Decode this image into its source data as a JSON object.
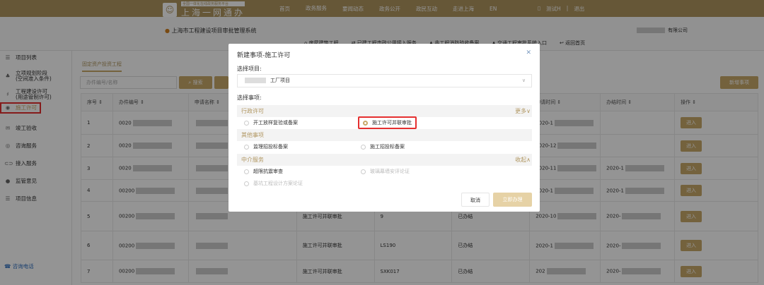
{
  "header": {
    "logo_sub": "全国一体化在线政务服务平台",
    "logo_title": "上海一网通办",
    "nav": [
      "首页",
      "政务服务",
      "要闻动态",
      "政务公开",
      "政民互动",
      "走进上海",
      "EN"
    ],
    "active_nav": 1,
    "user": "测试H",
    "sep": "|",
    "logout": "退出"
  },
  "subheader": {
    "system_name": "上海市工程建设项目审批管理系统",
    "company": "有限公司",
    "links": [
      "房屋建筑工程",
      "已建工程市政公用接入服务",
      "非工程消防验收备案",
      "交通工程审批系统入口",
      "返回首页"
    ]
  },
  "sidebar": {
    "items": [
      "项目列表",
      "立项规划阶段\n(空间准入条件)",
      "工程建设许可\n(用途管制许可)",
      "施工许可",
      "竣工验收",
      "咨询服务",
      "接入服务",
      "监管意见",
      "项目信息"
    ],
    "active": 3,
    "phone": "咨询电话"
  },
  "main": {
    "tab": "固定资产投资工程",
    "search_placeholder": "办件编号/名称",
    "search_btn": "搜索",
    "add_btn": "新增事项",
    "columns": [
      "序号 ⇕",
      "办件编号 ⇕",
      "申请名称 ⇕",
      "事项名称",
      "",
      "",
      "申请时间 ⇕",
      "办结时间 ⇕",
      "操作 ⇕"
    ],
    "rows": [
      {
        "no": "1",
        "code": "0020",
        "item": "",
        "num": "",
        "status": "",
        "apply": "2020-1",
        "done": "",
        "op": "进入"
      },
      {
        "no": "2",
        "code": "0020",
        "item": "",
        "num": "",
        "status": "",
        "apply": "2020-12",
        "done": "",
        "op": "进入"
      },
      {
        "no": "3",
        "code": "0020",
        "item": "",
        "num": "",
        "status": "",
        "apply": "2020-11",
        "done": "2020-1",
        "op": "进入"
      },
      {
        "no": "4",
        "code": "00200",
        "item": "",
        "num": "",
        "status": "",
        "apply": "2020-1",
        "done": "2020-1",
        "op": "进入"
      },
      {
        "no": "5",
        "code": "00200",
        "item": "施工许可并联审批",
        "num": "9",
        "status": "已办结",
        "apply": "2020-10",
        "done": "2020-",
        "op": "进入"
      },
      {
        "no": "6",
        "code": "00200",
        "item": "施工许可并联审批",
        "num": "LS190",
        "status": "已办结",
        "apply": "2020-1",
        "done": "2020-",
        "op": "进入"
      },
      {
        "no": "7",
        "code": "00200",
        "item": "施工许可并联审批",
        "num": "SXK017",
        "status": "已办结",
        "apply": "202",
        "done": "2020-",
        "op": "进入"
      }
    ]
  },
  "modal": {
    "title": "新建事项-施工许可",
    "project_label": "选择项目:",
    "project_value": "工厂项目",
    "matter_label": "选择事项:",
    "sections": [
      {
        "name": "行政许可",
        "toggle": "更多∨",
        "options": [
          "开工放样复验或备案",
          "施工许可并联审批"
        ]
      },
      {
        "name": "其他事项",
        "toggle": "",
        "options": [
          "监理招投标备案",
          "施工招投标备案"
        ]
      },
      {
        "name": "中介服务",
        "toggle": "收起∧",
        "options": [
          "超限抗震审查",
          "玻璃幕墙安评论证",
          "基坑工程设计方案论证"
        ]
      }
    ],
    "selected": "施工许可并联审批",
    "cancel": "取消",
    "submit": "立即办理"
  },
  "colors": {
    "brand": "#b09660",
    "accent": "#c8a96a",
    "highlight": "#e53030"
  }
}
